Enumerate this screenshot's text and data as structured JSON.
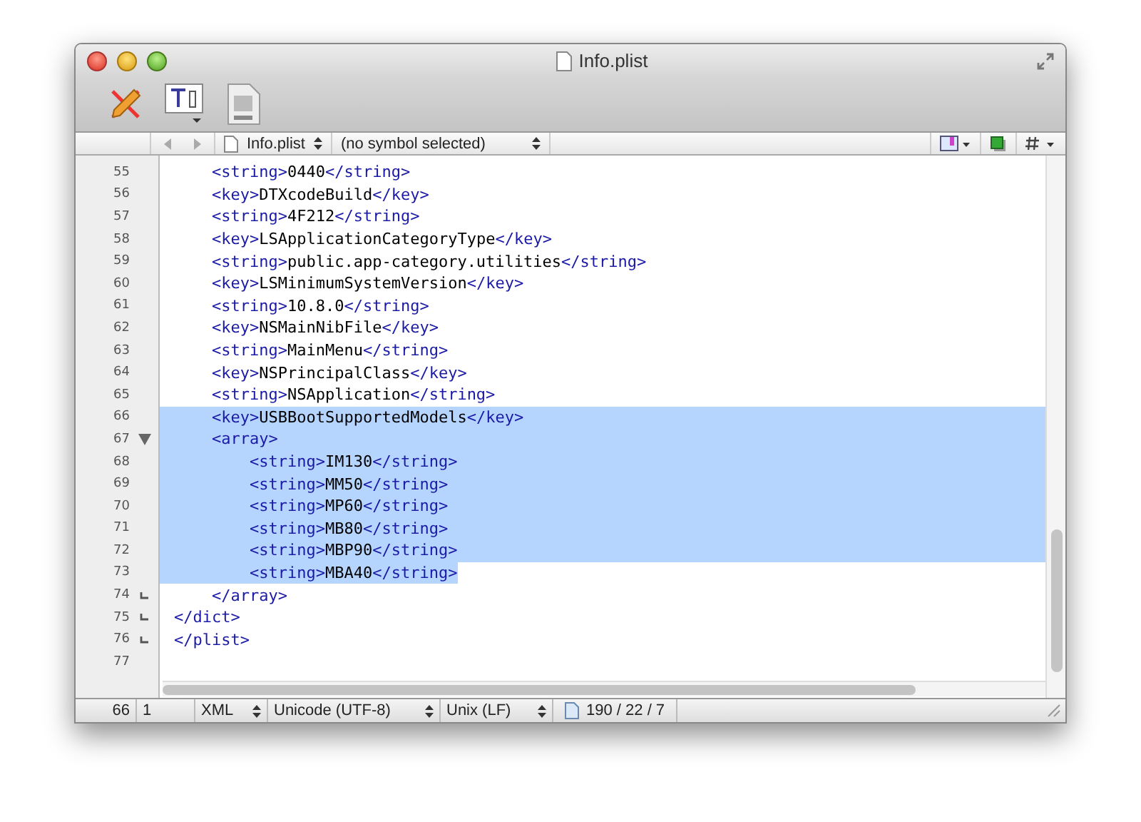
{
  "window": {
    "title": "Info.plist"
  },
  "navigation_bar": {
    "file": "Info.plist",
    "symbol": "(no symbol selected)"
  },
  "editor": {
    "lines": [
      {
        "number": "55",
        "text": "    <string>0440</string>",
        "selected": false
      },
      {
        "number": "56",
        "text": "    <key>DTXcodeBuild</key>",
        "selected": false
      },
      {
        "number": "57",
        "text": "    <string>4F212</string>",
        "selected": false
      },
      {
        "number": "58",
        "text": "    <key>LSApplicationCategoryType</key>",
        "selected": false
      },
      {
        "number": "59",
        "text": "    <string>public.app-category.utilities</string>",
        "selected": false
      },
      {
        "number": "60",
        "text": "    <key>LSMinimumSystemVersion</key>",
        "selected": false
      },
      {
        "number": "61",
        "text": "    <string>10.8.0</string>",
        "selected": false
      },
      {
        "number": "62",
        "text": "    <key>NSMainNibFile</key>",
        "selected": false
      },
      {
        "number": "63",
        "text": "    <string>MainMenu</string>",
        "selected": false
      },
      {
        "number": "64",
        "text": "    <key>NSPrincipalClass</key>",
        "selected": false
      },
      {
        "number": "65",
        "text": "    <string>NSApplication</string>",
        "selected": false
      },
      {
        "number": "66",
        "text": "    <key>USBBootSupportedModels</key>",
        "selected": true
      },
      {
        "number": "67",
        "text": "    <array>",
        "selected": true,
        "fold_start": true
      },
      {
        "number": "68",
        "text": "        <string>IM130</string>",
        "selected": true
      },
      {
        "number": "69",
        "text": "        <string>MM50</string>",
        "selected": true
      },
      {
        "number": "70",
        "text": "        <string>MP60</string>",
        "selected": true
      },
      {
        "number": "71",
        "text": "        <string>MB80</string>",
        "selected": true
      },
      {
        "number": "72",
        "text": "        <string>MBP90</string>",
        "selected": true
      },
      {
        "number": "73",
        "text": "        <string>MBA40</string>",
        "selected": true
      },
      {
        "number": "74",
        "text": "    </array>",
        "selected": false,
        "fold_end": true
      },
      {
        "number": "75",
        "text": "</dict>",
        "selected": false,
        "fold_end": true
      },
      {
        "number": "76",
        "text": "</plist>",
        "selected": false,
        "fold_end": true
      },
      {
        "number": "77",
        "selected": false
      }
    ]
  },
  "status_bar": {
    "line": "66",
    "column": "1",
    "syntax": "XML",
    "encoding": "Unicode (UTF-8)",
    "line_endings": "Unix (LF)",
    "counts": "190 / 22 / 7"
  }
}
